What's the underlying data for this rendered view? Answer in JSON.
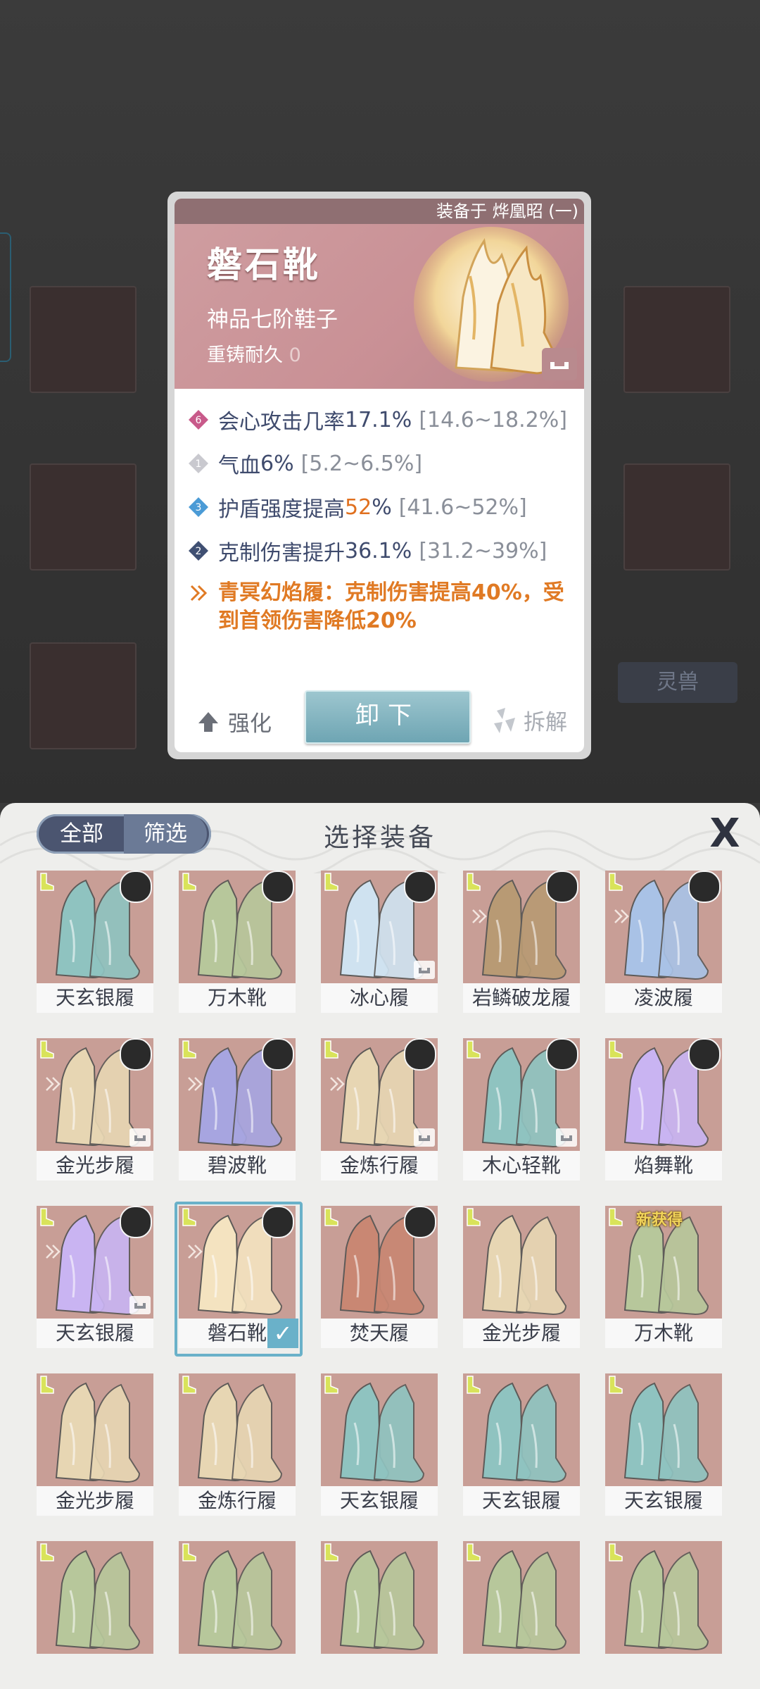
{
  "background": {
    "spirit_beast_button": "灵兽"
  },
  "detail_card": {
    "equipped_on": "装备于 烨凰昭 (一)",
    "name": "磐石靴",
    "grade": "神品七阶鞋子",
    "durability_label": "重铸耐久",
    "durability_value": "0",
    "stats": [
      {
        "badge": "6",
        "badge_color": "#c85a8a",
        "name": "会心攻击几率",
        "value": " 17.1%",
        "range": "[14.6~18.2%]"
      },
      {
        "badge": "1",
        "badge_color": "#c9c9cf",
        "name": "气血",
        "value": " 6%",
        "range": "[5.2~6.5%]"
      },
      {
        "badge": "3",
        "badge_color": "#4b9bd6",
        "name": "护盾强度提高",
        "value": " 52",
        "value_suffix": "%",
        "range": "[41.6~52%]"
      },
      {
        "badge": "2",
        "badge_color": "#3f4f72",
        "name": "克制伤害提升",
        "value": "36.1%",
        "range": "[31.2~39%]"
      }
    ],
    "set_bonus": "青冥幻焰履：克制伤害提高40%，受到首领伤害降低20%",
    "unequip_label": "卸下",
    "enhance_label": "强化",
    "dismantle_label": "拆解"
  },
  "panel": {
    "tab_all": "全部",
    "tab_filter": "筛选",
    "title": "选择装备",
    "close": "X",
    "new_tag": "新获得",
    "items": [
      {
        "name": "天玄银履",
        "palette": "teal",
        "avatar": true,
        "lock": false,
        "set": false
      },
      {
        "name": "万木靴",
        "palette": "green",
        "avatar": true,
        "lock": false,
        "set": false
      },
      {
        "name": "冰心履",
        "palette": "ice",
        "avatar": true,
        "lock": true,
        "set": false
      },
      {
        "name": "岩鳞破龙履",
        "palette": "brown",
        "avatar": true,
        "lock": false,
        "set": true
      },
      {
        "name": "凌波履",
        "palette": "blue",
        "avatar": true,
        "lock": false,
        "set": true
      },
      {
        "name": "金光步履",
        "palette": "gold",
        "avatar": true,
        "lock": true,
        "set": true
      },
      {
        "name": "碧波靴",
        "palette": "purple",
        "avatar": true,
        "lock": false,
        "set": true
      },
      {
        "name": "金炼行履",
        "palette": "gold",
        "avatar": true,
        "lock": true,
        "set": true
      },
      {
        "name": "木心轻靴",
        "palette": "teal",
        "avatar": true,
        "lock": true,
        "set": false
      },
      {
        "name": "焰舞靴",
        "palette": "flame-blue",
        "avatar": true,
        "lock": false,
        "set": false
      },
      {
        "name": "天玄银履",
        "palette": "flame-blue",
        "avatar": true,
        "lock": true,
        "set": true
      },
      {
        "name": "磐石靴",
        "palette": "flame-gold",
        "avatar": true,
        "lock": false,
        "set": true,
        "selected": true
      },
      {
        "name": "焚天履",
        "palette": "red",
        "avatar": true,
        "lock": false,
        "set": false
      },
      {
        "name": "金光步履",
        "palette": "gold",
        "avatar": false,
        "lock": false,
        "set": false
      },
      {
        "name": "万木靴",
        "palette": "green",
        "avatar": false,
        "lock": false,
        "set": false,
        "new": true
      },
      {
        "name": "金光步履",
        "palette": "gold",
        "avatar": false,
        "lock": false,
        "set": false
      },
      {
        "name": "金炼行履",
        "palette": "gold",
        "avatar": false,
        "lock": false,
        "set": false
      },
      {
        "name": "天玄银履",
        "palette": "teal",
        "avatar": false,
        "lock": false,
        "set": false
      },
      {
        "name": "天玄银履",
        "palette": "teal",
        "avatar": false,
        "lock": false,
        "set": false
      },
      {
        "name": "天玄银履",
        "palette": "teal",
        "avatar": false,
        "lock": false,
        "set": false
      },
      {
        "name": "",
        "palette": "green",
        "avatar": false,
        "lock": false,
        "set": false
      },
      {
        "name": "",
        "palette": "green",
        "avatar": false,
        "lock": false,
        "set": false
      },
      {
        "name": "",
        "palette": "green",
        "avatar": false,
        "lock": false,
        "set": false
      },
      {
        "name": "",
        "palette": "green",
        "avatar": false,
        "lock": false,
        "set": false
      },
      {
        "name": "",
        "palette": "green",
        "avatar": false,
        "lock": false,
        "set": false
      }
    ]
  },
  "palettes": {
    "teal": "#8fc3c0",
    "green": "#b7c79b",
    "ice": "#cfe2f0",
    "brown": "#b89a74",
    "blue": "#a9c2e6",
    "gold": "#e7d6b3",
    "purple": "#a7a5e0",
    "flame-blue": "#c9b4f2",
    "flame-gold": "#f4e3c0",
    "red": "#c98773"
  }
}
